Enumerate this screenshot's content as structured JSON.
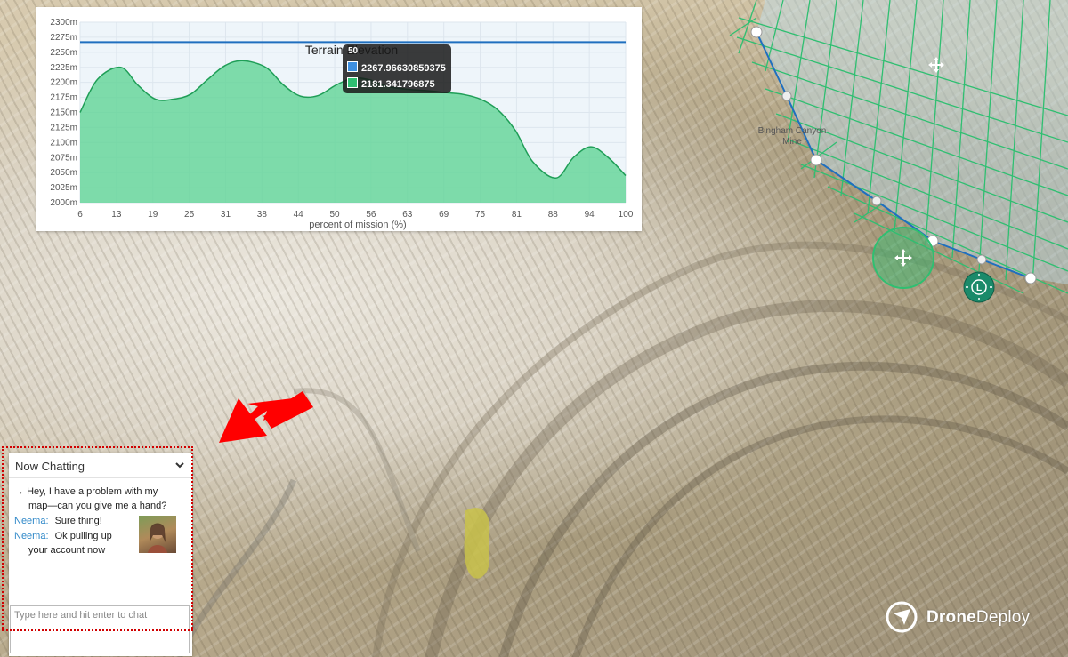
{
  "map": {
    "location_label_line1": "Bingham Canyon",
    "location_label_line2": "Mine"
  },
  "chart_data": {
    "type": "area",
    "title": "Terrain Elevation",
    "xlabel": "percent of mission (%)",
    "ylabel": "",
    "x_ticks": [
      "6",
      "13",
      "19",
      "25",
      "31",
      "38",
      "44",
      "50",
      "56",
      "63",
      "69",
      "75",
      "81",
      "88",
      "94",
      "100"
    ],
    "y_ticks": [
      "2000m",
      "2025m",
      "2050m",
      "2075m",
      "2100m",
      "2125m",
      "2150m",
      "2175m",
      "2200m",
      "2225m",
      "2250m",
      "2275m",
      "2300m"
    ],
    "xlim": [
      6,
      100
    ],
    "ylim": [
      2000,
      2300
    ],
    "series": [
      {
        "name": "",
        "color": "#1f6fbf",
        "x": [
          6,
          100
        ],
        "y": [
          2267,
          2267
        ]
      },
      {
        "name": "",
        "color": "#2fbf71",
        "x": [
          6,
          9,
          13,
          16,
          19,
          22,
          25,
          28,
          31,
          34,
          38,
          41,
          44,
          47,
          50,
          53,
          56,
          59,
          63,
          66,
          69,
          72,
          75,
          78,
          81,
          84,
          88,
          91,
          94,
          97,
          100
        ],
        "y": [
          2150,
          2205,
          2225,
          2195,
          2172,
          2172,
          2180,
          2205,
          2228,
          2236,
          2225,
          2196,
          2177,
          2178,
          2195,
          2207,
          2204,
          2193,
          2188,
          2186,
          2183,
          2180,
          2172,
          2154,
          2120,
          2068,
          2041,
          2075,
          2093,
          2075,
          2045
        ]
      }
    ],
    "tooltip": {
      "title": "50",
      "items": [
        {
          "color": "#3d8fe0",
          "value": "2267.96630859375"
        },
        {
          "color": "#2fbf71",
          "value": "2181.341796875"
        }
      ]
    },
    "grid": true,
    "legend": "none"
  },
  "chat": {
    "header_title": "Now Chatting",
    "messages": [
      {
        "prefix": "→",
        "sender": "",
        "text_line1": "Hey, I have a problem with my",
        "text_line2": "map—can you give me a hand?"
      },
      {
        "prefix": "",
        "sender": "Neema:",
        "text_line1": "Sure thing!",
        "text_line2": ""
      },
      {
        "prefix": "",
        "sender": "Neema:",
        "text_line1": "Ok pulling up",
        "text_line2": "your account now"
      }
    ],
    "input_placeholder": "Type here and hit enter to chat"
  },
  "brand": {
    "name_bold": "Drone",
    "name_regular": "Deploy"
  },
  "colors": {
    "flight_grid": "#2fbf71",
    "flight_boundary": "#1f6fbf",
    "chat_sender": "#2f88c8",
    "annotation_arrow": "#ff0000",
    "highlight_box": "#d00000"
  }
}
